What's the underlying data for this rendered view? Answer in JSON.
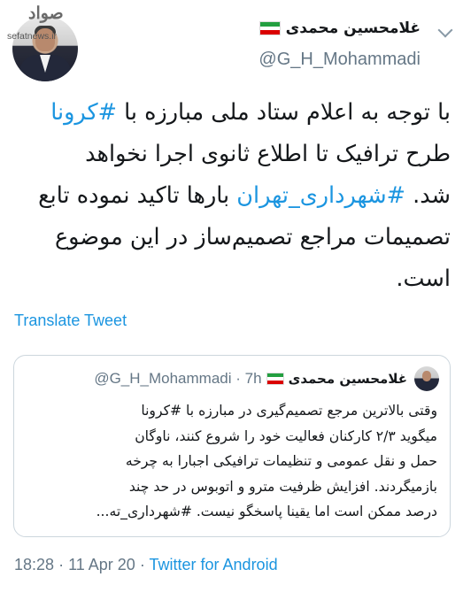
{
  "watermark": {
    "logo": "صواد",
    "site": "sefatnews.ir"
  },
  "author": {
    "display_name": "غلامحسین محمدی",
    "handle": "@G_H_Mohammadi",
    "flag_colors": [
      "#239f40",
      "#ffffff",
      "#da0000"
    ]
  },
  "tweet": {
    "lines": [
      {
        "pre": "با توجه به اعلام ستاد ملی مبارزه با ",
        "tag": "#کرونا",
        "post": ""
      },
      {
        "pre": "طرح ترافیک تا اطلاع ثانوی اجرا نخواهد",
        "tag": "",
        "post": ""
      },
      {
        "pre": "شد. ",
        "tag": "#شهرداری_تهران",
        "post": " بارها تاکید نموده تابع"
      },
      {
        "pre": "تصمیمات مراجع تصمیم‌ساز در این موضوع",
        "tag": "",
        "post": ""
      },
      {
        "pre": "است.",
        "tag": "",
        "post": ""
      }
    ]
  },
  "translate_label": "Translate Tweet",
  "quoted": {
    "display_name": "غلامحسین محمدی",
    "handle": "@G_H_Mohammadi",
    "separator": "·",
    "time": "7h",
    "lines": [
      "وقتی بالاترین مرجع تصمیم‌گیری در مبارزه با #کرونا",
      "میگوید ۲/۳ کارکنان فعالیت خود را شروع کنند، ناوگان",
      "حمل و نقل عمومی و تنظیمات ترافیکی اجبارا به چرخه",
      "بازمیگردند. افزایش ظرفیت مترو و اتوبوس در حد چند",
      "درصد ممکن است اما یقینا پاسخگو نیست. #شهرداری_ته..."
    ]
  },
  "footer": {
    "time": "18:28",
    "separator1": "·",
    "date": "11 Apr 20",
    "separator2": "·",
    "app": "Twitter for Android"
  }
}
